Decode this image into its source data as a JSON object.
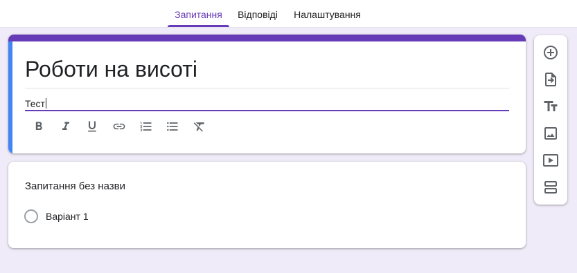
{
  "tabs": {
    "questions": "Запитання",
    "answers": "Відповіді",
    "settings": "Налаштування"
  },
  "form": {
    "title": "Роботи на висоті",
    "description": "Тест"
  },
  "format_toolbar": [
    "bold-icon",
    "italic-icon",
    "underline-icon",
    "link-icon",
    "numbered-list-icon",
    "bulleted-list-icon",
    "clear-formatting-icon"
  ],
  "question": {
    "title": "Запитання без назви",
    "option_1": "Варіант 1"
  },
  "side_toolbar": [
    "add-question-icon",
    "import-questions-icon",
    "add-title-icon",
    "add-image-icon",
    "add-video-icon",
    "add-section-icon"
  ],
  "colors": {
    "accent": "#673ab7",
    "focus_bar": "#4285f4",
    "background": "#f0ebf8",
    "icon": "#5f6368"
  }
}
